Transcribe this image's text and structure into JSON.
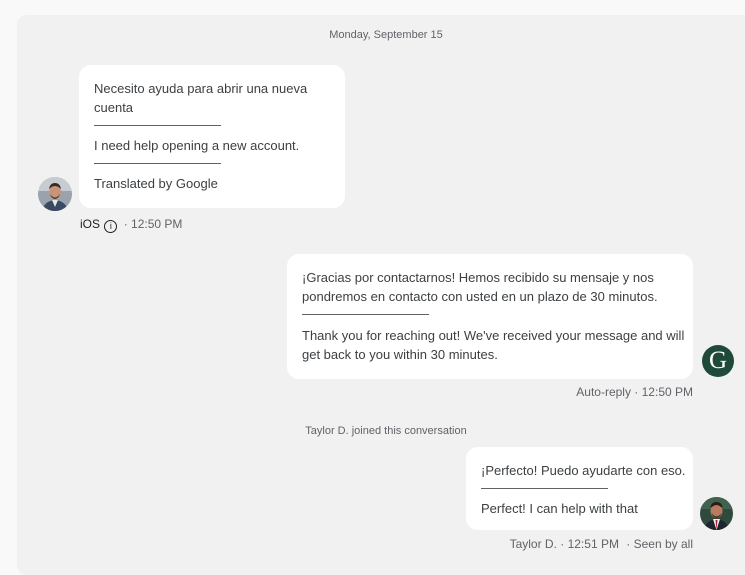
{
  "conversation": {
    "date_separator": "Monday, September 15",
    "messages": [
      {
        "original": "Necesito ayuda para abrir una nueva cuenta",
        "translation": "I need help opening a new account.",
        "translated_by": "Translated by Google",
        "platform": "iOS",
        "time": "· 12:50 PM"
      },
      {
        "original": "¡Gracias por contactarnos! Hemos recibido su mensaje y nos pondremos en contacto con usted en un plazo de 30 minutos.",
        "translation": "Thank you for reaching out! We've received your message and will get back to you within 30 minutes.",
        "meta": "Auto-reply · 12:50 PM",
        "avatar_letter": "G"
      },
      {
        "original": "¡Perfecto! Puedo ayudarte con eso.",
        "translation": "Perfect! I can help with that",
        "meta": "Taylor D. · 12:51 PM",
        "seen": "· Seen by all"
      }
    ],
    "system_message": "Taylor D. joined this conversation"
  },
  "colors": {
    "background": "#f1f1f1",
    "bubble": "#ffffff",
    "bot_avatar": "#1f4a3a"
  },
  "icons": [
    "info-icon",
    "customer-avatar",
    "bot-avatar",
    "agent-avatar"
  ]
}
